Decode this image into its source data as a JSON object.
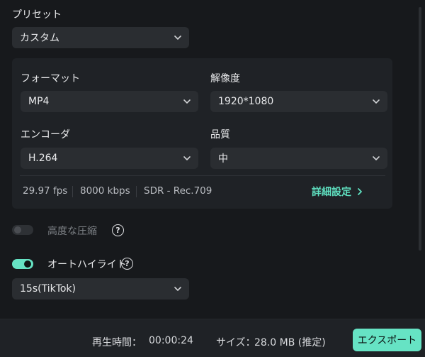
{
  "preset": {
    "label": "プリセット",
    "value": "カスタム"
  },
  "settings": {
    "format": {
      "label": "フォーマット",
      "value": "MP4"
    },
    "resolution": {
      "label": "解像度",
      "value": "1920*1080"
    },
    "encoder": {
      "label": "エンコーダ",
      "value": "H.264"
    },
    "quality": {
      "label": "品質",
      "value": "中"
    },
    "stats": {
      "fps": "29.97 fps",
      "bitrate": "8000 kbps",
      "color": "SDR - Rec.709"
    },
    "advanced_link": "詳細設定"
  },
  "advanced_compression": {
    "label": "高度な圧縮",
    "enabled": false,
    "disabled": true
  },
  "auto_highlight": {
    "label": "オートハイライト",
    "enabled": true,
    "value": "15s(TikTok)"
  },
  "footer": {
    "duration_label": "再生時間：",
    "duration_value": "00:00:24",
    "size_label": "サイズ：",
    "size_value": "28.0 MB (推定)",
    "export_label": "エクスポート"
  },
  "colors": {
    "accent": "#66e3c4",
    "link": "#5fe0c0",
    "background": "#17191c",
    "panel": "#1f2226",
    "field": "#2a2d31"
  },
  "icons": {
    "dropdown": "chevron-down-icon",
    "advanced": "chevron-right-icon",
    "help": "question-circle-icon"
  }
}
